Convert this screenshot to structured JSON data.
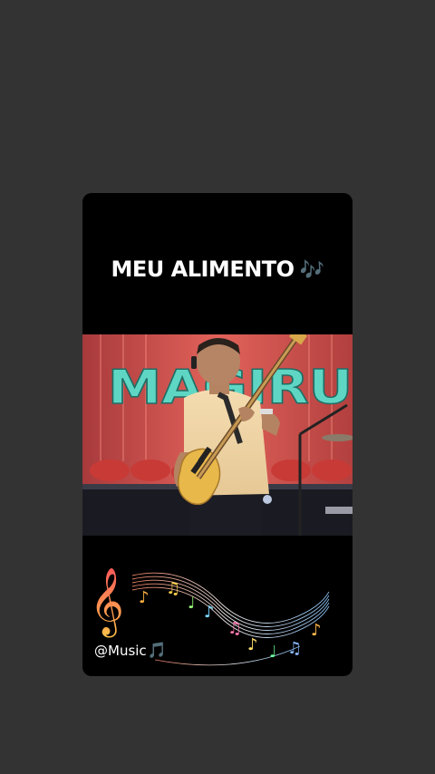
{
  "story": {
    "caption": "MEU ALIMENTO",
    "caption_emoji": "🎶",
    "video_sign_text": "MAGIRU",
    "handle": "@Music",
    "handle_emoji": "🎵"
  },
  "colors": {
    "app_background": "#333333",
    "card_background": "#000000",
    "sign_teal": "#5fd6c4",
    "stage_red": "#d94a45"
  },
  "icons": [
    "treble-clef-icon",
    "music-notes-icon",
    "music-note-emoji-icon"
  ]
}
